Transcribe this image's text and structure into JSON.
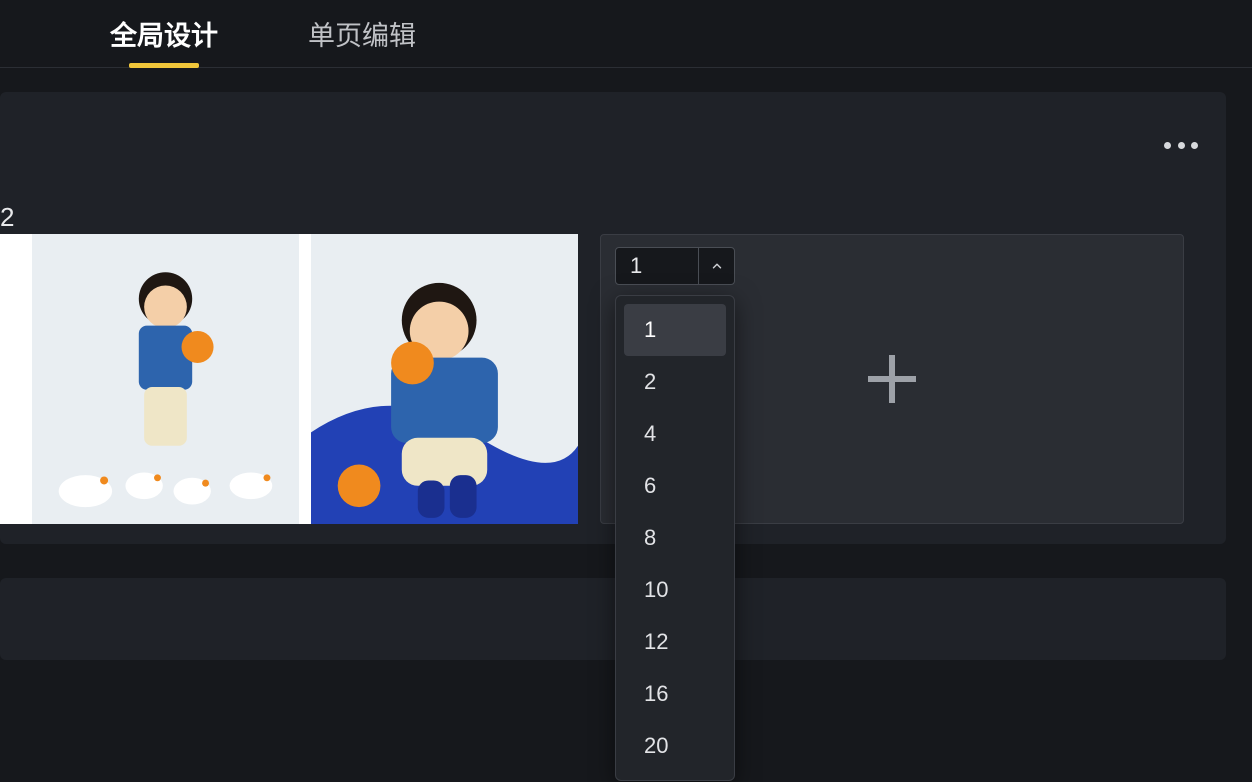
{
  "tabs": [
    {
      "label": "全局设计",
      "active": true
    },
    {
      "label": "单页编辑",
      "active": false
    }
  ],
  "section": {
    "page_label": "2"
  },
  "count_select": {
    "value": "1",
    "options": [
      "1",
      "2",
      "4",
      "6",
      "8",
      "10",
      "12",
      "16",
      "20"
    ],
    "selected": "1"
  }
}
